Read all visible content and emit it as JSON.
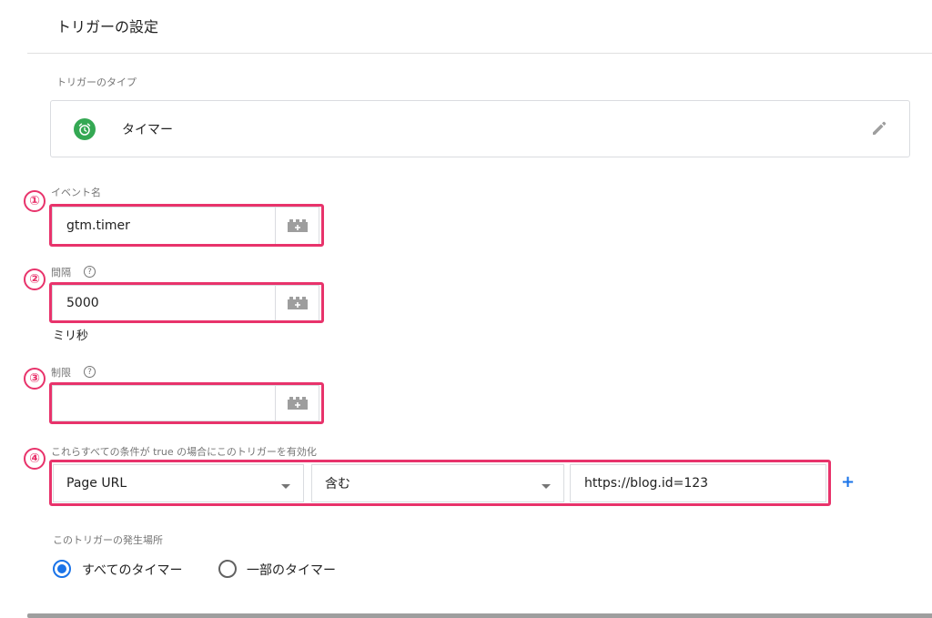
{
  "header": {
    "title": "トリガーの設定"
  },
  "trigger_type": {
    "section_label": "トリガーのタイプ",
    "name": "タイマー",
    "icon": "timer-icon",
    "icon_color": "#34a853",
    "edit_icon": "pencil-icon"
  },
  "event_name": {
    "marker": "①",
    "label": "イベント名",
    "value": "gtm.timer",
    "variable_icon": "variable-icon"
  },
  "interval": {
    "marker": "②",
    "label": "間隔",
    "help": "?",
    "value": "5000",
    "units": "ミリ秒"
  },
  "limit": {
    "marker": "③",
    "label": "制限",
    "help": "?",
    "value": ""
  },
  "conditions": {
    "marker": "④",
    "label": "これらすべての条件が true の場合にこのトリガーを有効化",
    "variable": "Page URL",
    "operator": "含む",
    "value": "https://blog.id=123",
    "add": "+"
  },
  "fire_on": {
    "label": "このトリガーの発生場所",
    "options": [
      {
        "label": "すべてのタイマー",
        "selected": true
      },
      {
        "label": "一部のタイマー",
        "selected": false
      }
    ]
  },
  "colors": {
    "highlight": "#e8336b",
    "accent": "#1a73e8",
    "border": "#dadce0"
  }
}
